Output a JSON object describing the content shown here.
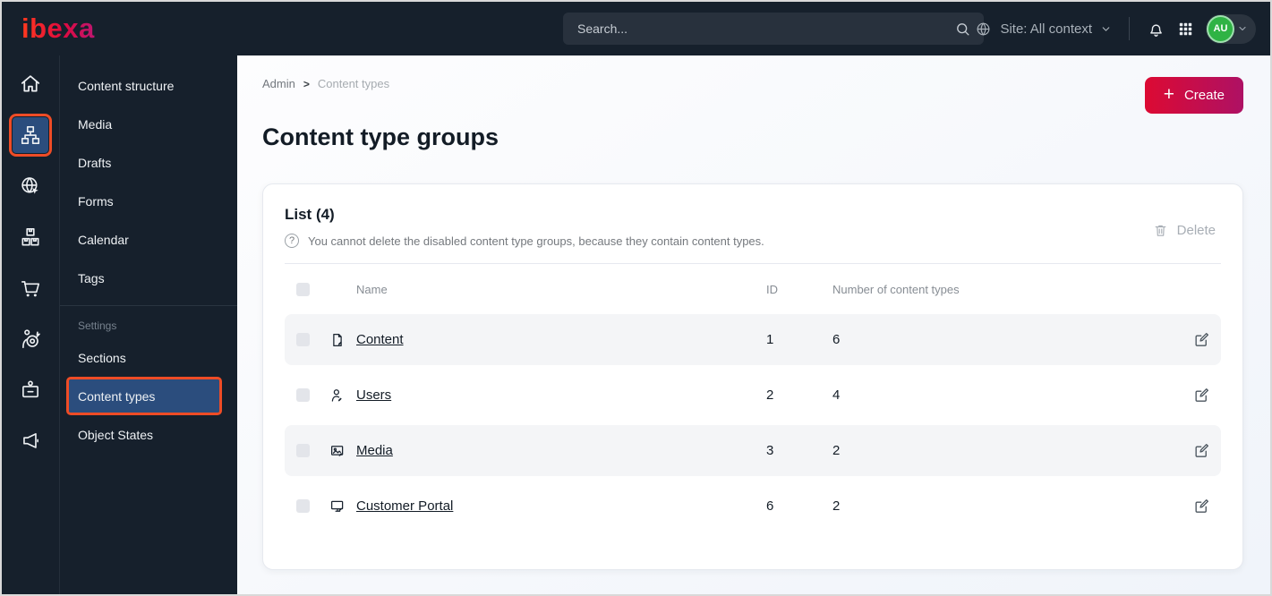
{
  "topbar": {
    "logo_text": "ibexa",
    "search": {
      "placeholder": "Search..."
    },
    "site_context": {
      "label": "Site: All context"
    },
    "avatar_initials": "AU"
  },
  "sidebar": {
    "items": [
      {
        "label": "Content structure"
      },
      {
        "label": "Media"
      },
      {
        "label": "Drafts"
      },
      {
        "label": "Forms"
      },
      {
        "label": "Calendar"
      },
      {
        "label": "Tags"
      }
    ],
    "settings_heading": "Settings",
    "settings_items": [
      {
        "label": "Sections"
      },
      {
        "label": "Content types",
        "active": true
      },
      {
        "label": "Object States"
      }
    ]
  },
  "main": {
    "breadcrumb": {
      "items": [
        "Admin",
        "Content types"
      ],
      "separator": ">"
    },
    "create_button": "Create",
    "page_title": "Content type groups",
    "panel": {
      "title": "List (4)",
      "hint": "You cannot delete the disabled content type groups, because they contain content types.",
      "delete_button": "Delete",
      "table": {
        "headers": {
          "name": "Name",
          "id": "ID",
          "count": "Number of content types"
        },
        "rows": [
          {
            "icon": "content-file-icon",
            "name": "Content",
            "id": "1",
            "count": "6"
          },
          {
            "icon": "users-icon",
            "name": "Users",
            "id": "2",
            "count": "4"
          },
          {
            "icon": "media-image-icon",
            "name": "Media",
            "id": "3",
            "count": "2"
          },
          {
            "icon": "customer-portal-icon",
            "name": "Customer Portal",
            "id": "6",
            "count": "2"
          }
        ]
      }
    }
  },
  "colors": {
    "topbar_bg": "#16202c",
    "accent_red": "#dc0a33",
    "accent_pink": "#ae1164",
    "active_blue": "#2b4d7d",
    "annotation_orange": "#ee4c26",
    "avatar_green": "#2fb344"
  }
}
